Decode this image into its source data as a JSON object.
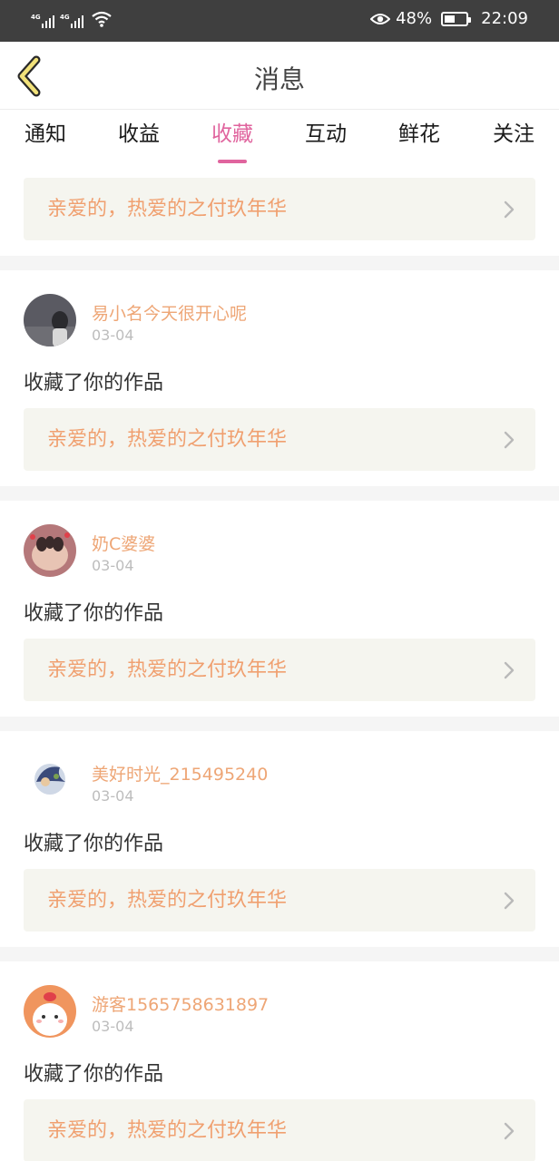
{
  "status_bar": {
    "network1": "4G",
    "network2": "4G",
    "battery_percent": "48%",
    "battery_level": 0.48,
    "time": "22:09"
  },
  "header": {
    "title": "消息",
    "back_icon": "chevron-left-icon"
  },
  "tabs": [
    {
      "label": "通知",
      "active": false
    },
    {
      "label": "收益",
      "active": false
    },
    {
      "label": "收藏",
      "active": true
    },
    {
      "label": "互动",
      "active": false
    },
    {
      "label": "鲜花",
      "active": false
    },
    {
      "label": "关注",
      "active": false
    }
  ],
  "colors": {
    "accent": "#e0649e",
    "work_title": "#f0a070",
    "username": "#eea676",
    "card_bg": "#f5f5ef",
    "separator": "#f5f5f5"
  },
  "top_work": {
    "title": "亲爱的，热爱的之付玖年华"
  },
  "messages": [
    {
      "username": "易小名今天很开心呢",
      "date": "03-04",
      "action": "收藏了你的作品",
      "work_title": "亲爱的，热爱的之付玖年华"
    },
    {
      "username": "奶C婆婆",
      "date": "03-04",
      "action": "收藏了你的作品",
      "work_title": "亲爱的，热爱的之付玖年华"
    },
    {
      "username": "美好时光_215495240",
      "date": "03-04",
      "action": "收藏了你的作品",
      "work_title": "亲爱的，热爱的之付玖年华"
    },
    {
      "username": "游客1565758631897",
      "date": "03-04",
      "action": "收藏了你的作品",
      "work_title": "亲爱的，热爱的之付玖年华"
    }
  ]
}
